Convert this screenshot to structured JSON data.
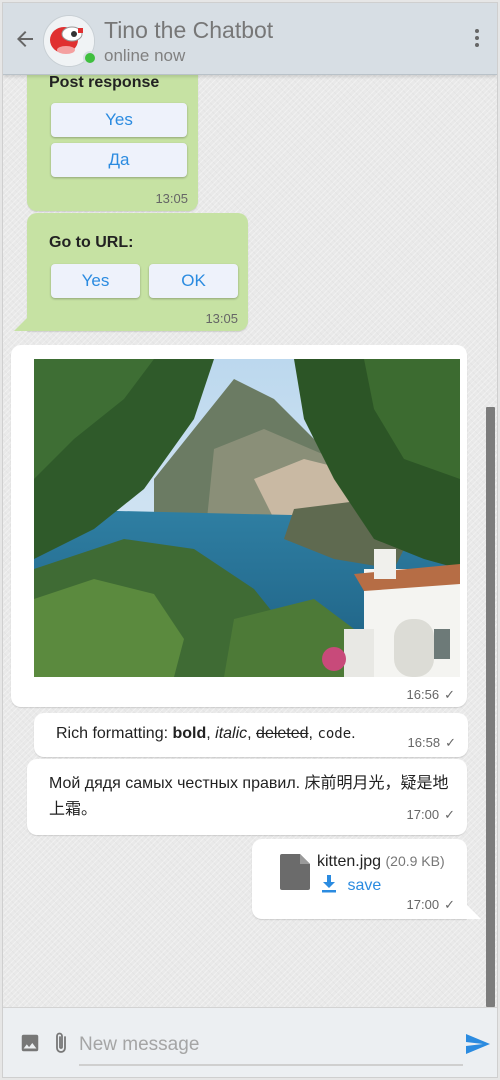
{
  "header": {
    "title": "Tino the Chatbot",
    "status": "online now"
  },
  "messages": {
    "post_response": {
      "label": "Post response",
      "buttons": [
        "Yes",
        "Да"
      ],
      "time": "13:05"
    },
    "go_to_url": {
      "label": "Go to URL:",
      "buttons": [
        "Yes",
        "OK"
      ],
      "time": "13:05"
    },
    "image_msg": {
      "time": "16:56"
    },
    "rich": {
      "prefix": "Rich formatting: ",
      "bold": "bold",
      "sep1": ", ",
      "italic": "italic",
      "sep2": ", ",
      "deleted": "deleted",
      "sep3": ", ",
      "code": "code",
      "end": ".",
      "time": "16:58"
    },
    "cyrillic": {
      "text": "Мой дядя самых честных правил. 床前明月光，疑是地上霜。",
      "time": "17:00"
    },
    "file": {
      "name": "kitten.jpg",
      "size": "(20.9 KB)",
      "save": "save",
      "time": "17:00"
    }
  },
  "composer": {
    "placeholder": "New message"
  },
  "colors": {
    "accent": "#2b8be0",
    "bubble_green": "#c6e2a3",
    "online": "#3fbf3f"
  }
}
